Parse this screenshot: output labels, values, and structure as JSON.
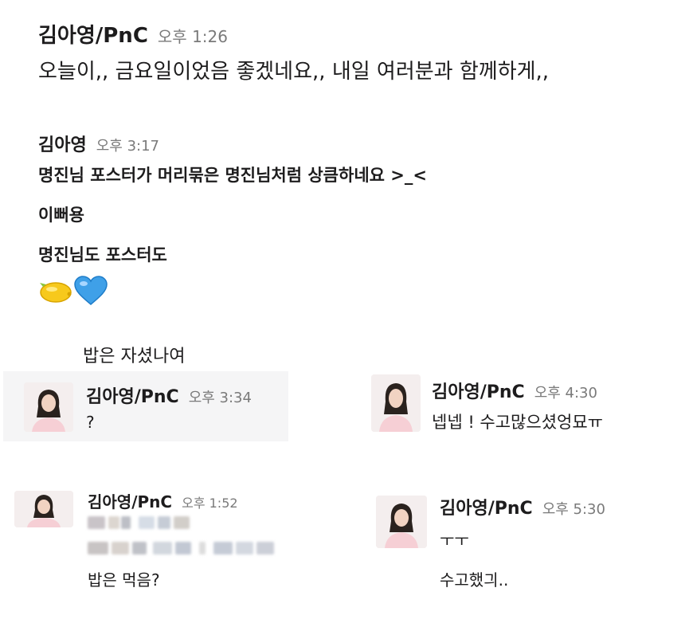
{
  "top_message": {
    "sender": "김아영/PnC",
    "time": "오후 1:26",
    "text": "오늘이,, 금요일이었음 좋겠네요,, 내일 여러분과 함께하게,,"
  },
  "second_message": {
    "sender": "김아영",
    "time": "오후 3:17",
    "lines": [
      "명진님 포스터가 머리묶은 명진님처럼 상큼하네요 >_<",
      "이뻐용",
      "명진님도 포스터도"
    ],
    "emoji": [
      "lemon-emoji",
      "blue-heart-emoji"
    ]
  },
  "floating_text": "밥은 자셨나여",
  "card_a": {
    "sender": "김아영/PnC",
    "time": "오후 3:34",
    "text": "?"
  },
  "card_b": {
    "sender": "김아영/PnC",
    "time": "오후 4:30",
    "text": "넵넵 ! 수고많으셨엉묘ㅠ"
  },
  "card_c": {
    "sender": "김아영/PnC",
    "time": "오후 1:52",
    "text": "밥은 먹음?"
  },
  "card_d": {
    "sender": "김아영/PnC",
    "time": "오후 5:30",
    "line1": "ㅜㅜ",
    "line2": "수고했긔.."
  },
  "colors": {
    "card_a_highlight": "#f5f5f6",
    "text": "#1d1c1d",
    "time": "#7a7a7a"
  }
}
